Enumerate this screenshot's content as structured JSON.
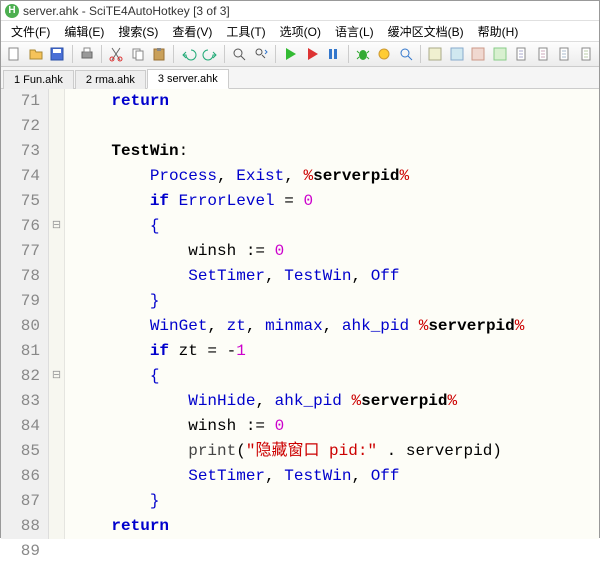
{
  "title": "server.ahk - SciTE4AutoHotkey [3 of 3]",
  "menu": [
    "文件(F)",
    "编辑(E)",
    "搜索(S)",
    "查看(V)",
    "工具(T)",
    "选项(O)",
    "语言(L)",
    "缓冲区文档(B)",
    "帮助(H)"
  ],
  "tabs": [
    {
      "label": "1 Fun.ahk",
      "active": false
    },
    {
      "label": "2 rma.ahk",
      "active": false
    },
    {
      "label": "3 server.ahk",
      "active": true
    }
  ],
  "lines": [
    {
      "n": 71,
      "fold": "",
      "html": "    <span class='kw-flow'>return</span>"
    },
    {
      "n": 72,
      "fold": "",
      "html": ""
    },
    {
      "n": 73,
      "fold": "",
      "html": "    <span class='label'>TestWin</span><span class='op'>:</span>"
    },
    {
      "n": 74,
      "fold": "",
      "html": "        <span class='kw-cmd'>Process</span><span class='op'>,</span> <span class='sub'>Exist</span><span class='op'>,</span> <span class='pct'>%</span><span class='kw-var'>serverpid</span><span class='pct'>%</span>"
    },
    {
      "n": 75,
      "fold": "",
      "html": "        <span class='kw-flow'>if</span> <span class='kw-cmd'>ErrorLevel</span> <span class='op'>=</span> <span class='num'>0</span>"
    },
    {
      "n": 76,
      "fold": "⊟",
      "html": "        <span class='brace'>{</span>"
    },
    {
      "n": 77,
      "fold": "",
      "html": "            winsh <span class='op'>:=</span> <span class='num'>0</span>"
    },
    {
      "n": 78,
      "fold": "",
      "html": "            <span class='kw-cmd'>SetTimer</span><span class='op'>,</span> <span class='sub'>TestWin</span><span class='op'>,</span> <span class='sub'>Off</span>"
    },
    {
      "n": 79,
      "fold": "",
      "html": "        <span class='brace'>}</span>"
    },
    {
      "n": 80,
      "fold": "",
      "html": "        <span class='kw-cmd'>WinGet</span><span class='op'>,</span> <span class='sub'>zt</span><span class='op'>,</span> <span class='sub'>minmax</span><span class='op'>,</span> <span class='sub'>ahk_pid</span> <span class='pct'>%</span><span class='kw-var'>serverpid</span><span class='pct'>%</span>"
    },
    {
      "n": 81,
      "fold": "",
      "html": "        <span class='kw-flow'>if</span> zt <span class='op'>=</span> <span class='op'>-</span><span class='num'>1</span>"
    },
    {
      "n": 82,
      "fold": "⊟",
      "html": "        <span class='brace'>{</span>"
    },
    {
      "n": 83,
      "fold": "",
      "html": "            <span class='kw-cmd'>WinHide</span><span class='op'>,</span> <span class='sub'>ahk_pid</span> <span class='pct'>%</span><span class='kw-var'>serverpid</span><span class='pct'>%</span>"
    },
    {
      "n": 84,
      "fold": "",
      "html": "            winsh <span class='op'>:=</span> <span class='num'>0</span>"
    },
    {
      "n": 85,
      "fold": "",
      "html": "            <span class='func'>print</span><span class='op'>(</span><span class='str'>\"隐藏窗口 pid:\"</span> <span class='op'>.</span> serverpid<span class='op'>)</span>"
    },
    {
      "n": 86,
      "fold": "",
      "html": "            <span class='kw-cmd'>SetTimer</span><span class='op'>,</span> <span class='sub'>TestWin</span><span class='op'>,</span> <span class='sub'>Off</span>"
    },
    {
      "n": 87,
      "fold": "",
      "html": "        <span class='brace'>}</span>"
    },
    {
      "n": 88,
      "fold": "",
      "html": "    <span class='kw-flow'>return</span>"
    },
    {
      "n": 89,
      "fold": "",
      "html": ""
    }
  ],
  "toolbar_icons": [
    "new",
    "open",
    "save",
    "sep",
    "print",
    "sep",
    "cut",
    "copy",
    "paste",
    "sep",
    "undo",
    "redo",
    "sep",
    "find",
    "replace",
    "sep",
    "run-green",
    "run-red",
    "pause",
    "sep",
    "debug-bug",
    "step",
    "zoom",
    "sep",
    "a",
    "b",
    "c",
    "d",
    "doc1",
    "doc2",
    "doc3",
    "doc4"
  ]
}
